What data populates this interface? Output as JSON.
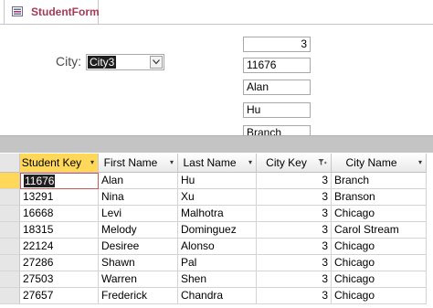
{
  "tab": {
    "label": "StudentForm",
    "icon": "form-icon"
  },
  "form": {
    "city_label": "City:",
    "city_combo_value": "City3",
    "city_key_value": "3",
    "student_key_value": "11676",
    "first_name_value": "Alan",
    "last_name_value": "Hu",
    "city_name_value": "Branch"
  },
  "datasheet": {
    "columns": [
      {
        "label": "Student Key",
        "indicator": "▾"
      },
      {
        "label": "First Name",
        "indicator": "▾"
      },
      {
        "label": "Last Name",
        "indicator": "▾"
      },
      {
        "label": "City Key",
        "indicator": "filter-icon"
      },
      {
        "label": "City Name",
        "indicator": "▾"
      }
    ],
    "rows": [
      [
        "11676",
        "Alan",
        "Hu",
        "3",
        "Branch"
      ],
      [
        "13291",
        "Nina",
        "Xu",
        "3",
        "Branson"
      ],
      [
        "16668",
        "Levi",
        "Malhotra",
        "3",
        "Chicago"
      ],
      [
        "18315",
        "Melody",
        "Dominguez",
        "3",
        "Carol Stream"
      ],
      [
        "22124",
        "Desiree",
        "Alonso",
        "3",
        "Chicago"
      ],
      [
        "27286",
        "Shawn",
        "Pal",
        "3",
        "Chicago"
      ],
      [
        "27503",
        "Warren",
        "Shen",
        "3",
        "Chicago"
      ],
      [
        "27657",
        "Frederick",
        "Chandra",
        "3",
        "Chicago"
      ]
    ]
  },
  "colors": {
    "tab_text": "#a33b55",
    "selected_header": "#ffd85a",
    "splitter": "#c4c4c4"
  }
}
